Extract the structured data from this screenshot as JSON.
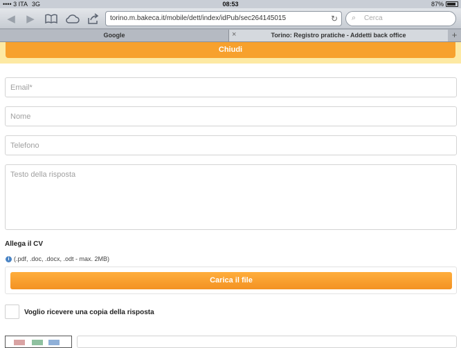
{
  "status": {
    "carrier": "3 ITA",
    "network": "3G",
    "time": "08:53",
    "battery": "87%",
    "battery_level": 0.87
  },
  "browser": {
    "url": "torino.m.bakeca.it/mobile/dett/index/idPub/sec264145015",
    "search_placeholder": "Cerca",
    "tabs": [
      {
        "label": "Google"
      },
      {
        "label": "Torino: Registro pratiche - Addetti back office"
      }
    ]
  },
  "page": {
    "close_label": "Chiudi",
    "email_placeholder": "Email*",
    "name_placeholder": "Nome",
    "phone_placeholder": "Telefono",
    "message_placeholder": "Testo della risposta",
    "cv_label": "Allega il CV",
    "cv_hint": "(.pdf, .doc, .docx, .odt - max. 2MB)",
    "upload_label": "Carica il file",
    "copy_label": "Voglio ricevere una copia della risposta"
  },
  "colors": {
    "accent": "#f7a12d",
    "banner": "#fde9a3"
  }
}
